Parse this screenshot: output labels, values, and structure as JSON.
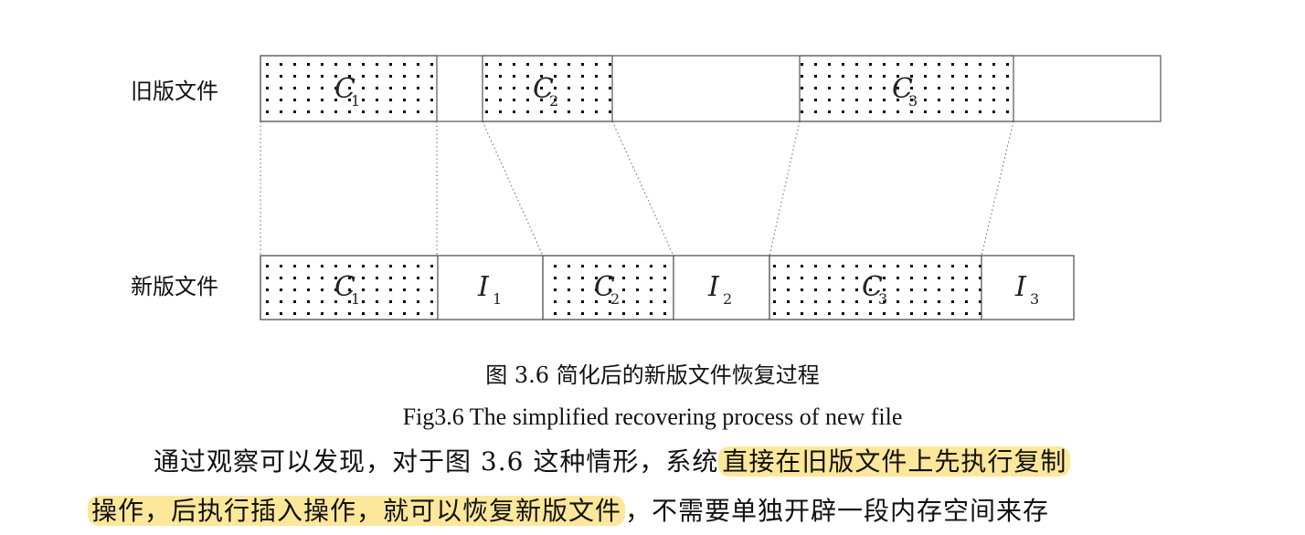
{
  "figure": {
    "row_labels": {
      "old": "旧版文件",
      "new": "新版文件"
    },
    "old_blocks": [
      {
        "letter": "C",
        "sub": "1"
      },
      {
        "letter": "C",
        "sub": "2"
      },
      {
        "letter": "C",
        "sub": "3"
      }
    ],
    "new_blocks": [
      {
        "letter": "C",
        "sub": "1"
      },
      {
        "letter": "I",
        "sub": "1"
      },
      {
        "letter": "C",
        "sub": "2"
      },
      {
        "letter": "I",
        "sub": "2"
      },
      {
        "letter": "C",
        "sub": "3"
      },
      {
        "letter": "I",
        "sub": "3"
      }
    ],
    "caption_cn": "图 3.6  简化后的新版文件恢复过程",
    "caption_en": "Fig3.6 The simplified recovering process of new file"
  },
  "paragraph": {
    "line1_plain": "通过观察可以发现，对于图  3.6  这种情形，系统",
    "line1_highlight": "直接在旧版文件上先执行复制",
    "line2_highlight": "操作，后执行插入操作，就可以恢复新版文件",
    "line2_plain": "，不需要单独开辟一段内存空间来存"
  },
  "colors": {
    "highlight": "#fde79a",
    "dots": "#000000",
    "border": "#555555"
  }
}
